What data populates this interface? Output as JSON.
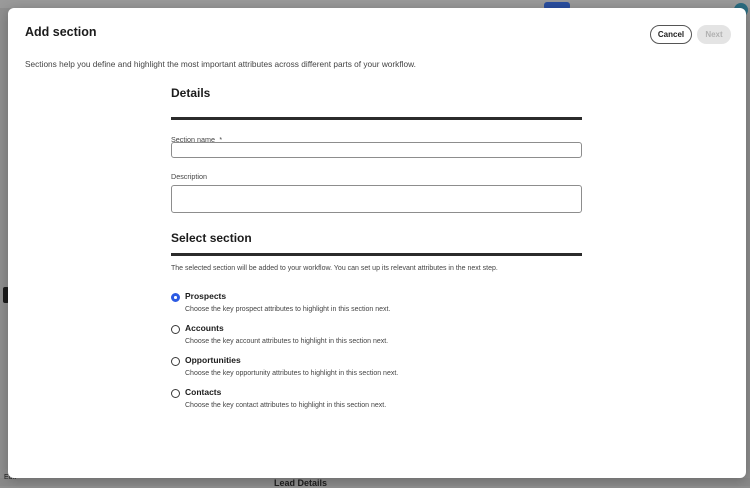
{
  "dialog": {
    "title": "Add section",
    "cancel_label": "Cancel",
    "next_label": "Next",
    "intro": "Sections help you define and highlight the most important attributes across different parts of your workflow."
  },
  "details": {
    "heading": "Details",
    "section_name_label": "Section name",
    "required_marker": "*",
    "section_name_value": "",
    "description_label": "Description",
    "description_value": ""
  },
  "select_section": {
    "heading": "Select section",
    "description": "The selected section will be added to your workflow. You can set up its relevant attributes in the next step.",
    "selected": "Prospects",
    "options": [
      {
        "label": "Prospects",
        "description": "Choose the key prospect attributes to highlight in this section next."
      },
      {
        "label": "Accounts",
        "description": "Choose the key account attributes to highlight in this section next."
      },
      {
        "label": "Opportunities",
        "description": "Choose the key opportunity attributes to highlight in this section next."
      },
      {
        "label": "Contacts",
        "description": "Choose the key contact attributes to highlight in this section next."
      }
    ]
  },
  "background": {
    "lead_heading": "Lead Details",
    "edit_label": "Edit"
  },
  "colors": {
    "accent": "#2d5be3",
    "overlay": "#8f8f8f"
  }
}
